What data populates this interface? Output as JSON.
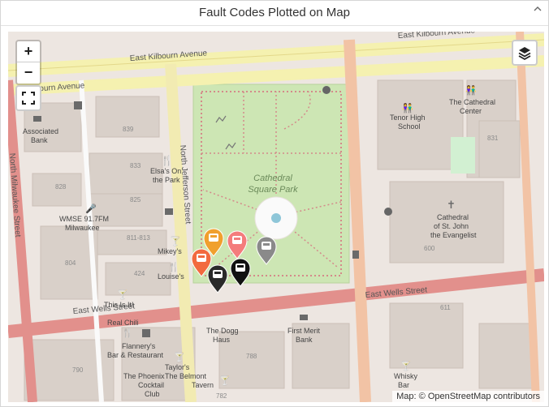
{
  "panel": {
    "title": "Fault Codes Plotted on Map",
    "collapse_icon": "chevron-up-icon"
  },
  "map": {
    "zoom_in": "+",
    "zoom_out": "−",
    "attribution": "Map: © OpenStreetMap contributors",
    "streets": {
      "kilbourn_1": "East Kilbourn Avenue",
      "kilbourn_2": "East Kilbourn Avenue",
      "kilbourn_3": "Ilbourn Avenue",
      "wells_1": "East Wells Street",
      "wells_2": "East Wells Street",
      "jefferson": "North Jefferson Street",
      "milwaukee": "North Milwaukee Street"
    },
    "park": {
      "line1": "Cathedral",
      "line2": "Square Park"
    },
    "places": {
      "associated_bank_1": "Associated",
      "associated_bank_2": "Bank",
      "elsas_1": "Elsa's On",
      "elsas_2": "the Park",
      "wmse_1": "WMSE 91.7FM",
      "wmse_2": "Milwaukee",
      "mikeys": "Mikey's",
      "louises": "Louise's",
      "this_is_it": "This Is It!",
      "real_chili": "Real Chili",
      "flannerys_1": "Flannery's",
      "flannerys_2": "Bar & Restaurant",
      "taylors_1": "Taylor's",
      "taylors_2": "The Belmont",
      "taylors_3": "Tavern",
      "phoenix_1": "The Phoenix",
      "phoenix_2": "Cocktail",
      "phoenix_3": "Club",
      "dogg_1": "The Dogg",
      "dogg_2": "Haus",
      "first_merit_1": "First Merit",
      "first_merit_2": "Bank",
      "tenor_1": "Tenor High",
      "tenor_2": "School",
      "cathedral_center_1": "The Cathedral",
      "cathedral_center_2": "Center",
      "cathedral_st_john_1": "Cathedral",
      "cathedral_st_john_2": "of St. John",
      "cathedral_st_john_3": "the Evangelist",
      "whisky_1": "Whisky",
      "whisky_2": "Bar"
    },
    "numbers": {
      "n839": "839",
      "n833": "833",
      "n828": "828",
      "n825": "825",
      "n811": "811-813",
      "n804": "804",
      "n424": "424",
      "n790": "790",
      "n788": "788",
      "n782": "782",
      "n831": "831",
      "n600": "600",
      "n611": "611"
    },
    "markers": [
      {
        "label": "fault-marker",
        "color": "#f0a02e"
      },
      {
        "label": "fault-marker",
        "color": "#f47c7c"
      },
      {
        "label": "fault-marker",
        "color": "#8a8a8a"
      },
      {
        "label": "fault-marker",
        "color": "#f26a3e"
      },
      {
        "label": "fault-marker",
        "color": "#2a2a2a"
      },
      {
        "label": "fault-marker",
        "color": "#111111"
      }
    ]
  }
}
